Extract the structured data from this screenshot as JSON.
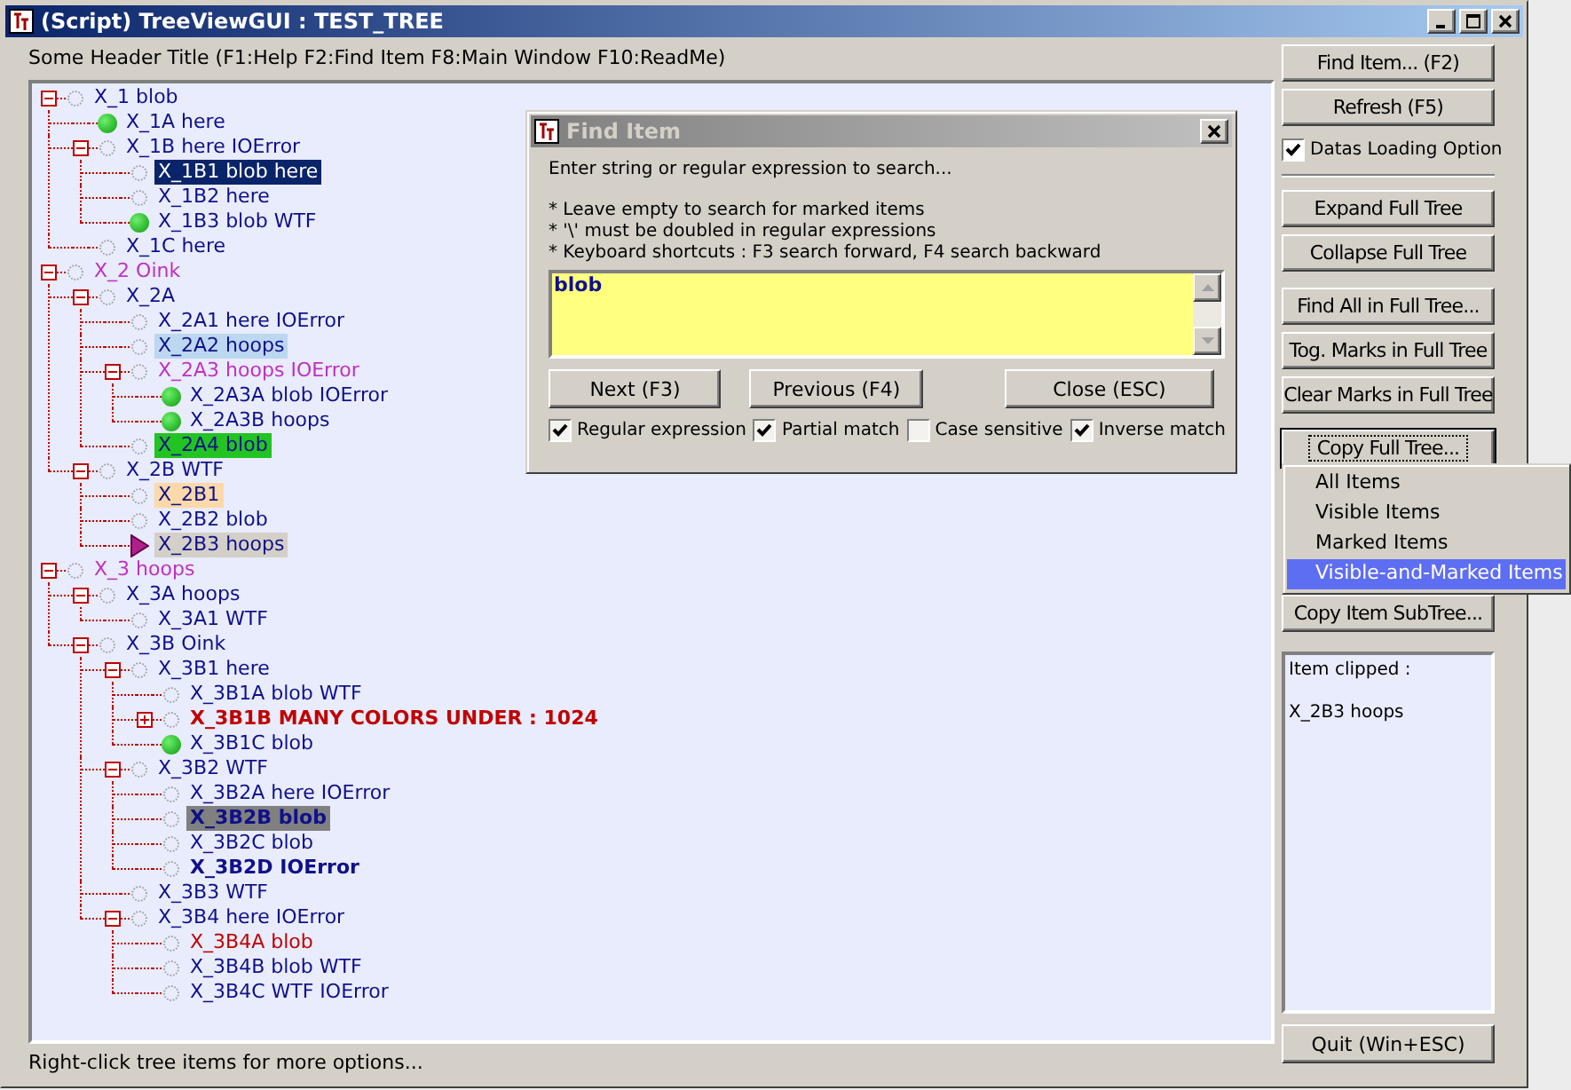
{
  "window": {
    "title": "(Script) TreeViewGUI : TEST_TREE"
  },
  "header": "Some Header Title (F1:Help F2:Find Item F8:Main Window F10:ReadMe)",
  "tree": [
    {
      "label": "X_1 blob",
      "kind": "plain",
      "color": "#10108a",
      "highlighted": false,
      "bold": false,
      "expanded": true,
      "children": [
        {
          "label": "X_1A here",
          "kind": "marked",
          "color": "#10108a",
          "highlighted": false,
          "bold": false
        },
        {
          "label": "X_1B here IOError",
          "kind": "plain",
          "color": "#10108a",
          "highlighted": false,
          "bold": false,
          "expanded": true,
          "children": [
            {
              "label": "X_1B1 blob here",
              "kind": "plain",
              "color": "#0a246a",
              "highlighted": true,
              "bold": false
            },
            {
              "label": "X_1B2 here",
              "kind": "plain",
              "color": "#10108a",
              "highlighted": false,
              "bold": false
            },
            {
              "label": "X_1B3 blob WTF",
              "kind": "marked",
              "color": "#10108a",
              "highlighted": false,
              "bold": false
            }
          ]
        },
        {
          "label": "X_1C here",
          "kind": "plain",
          "color": "#10108a",
          "highlighted": false,
          "bold": false
        }
      ]
    },
    {
      "label": "X_2 Oink",
      "kind": "plain",
      "color": "#c030c0",
      "highlighted": false,
      "bold": false,
      "expanded": true,
      "children": [
        {
          "label": "X_2A",
          "kind": "plain",
          "color": "#10108a",
          "highlighted": false,
          "bold": false,
          "expanded": true,
          "children": [
            {
              "label": "X_2A1 here IOError",
              "kind": "plain",
              "color": "#10108a",
              "highlighted": false,
              "bold": false
            },
            {
              "label": "X_2A2 hoops",
              "kind": "plain",
              "color": "#bcd7ef",
              "highlighted": true,
              "bold": false
            },
            {
              "label": "X_2A3 hoops IOError",
              "kind": "plain",
              "color": "#c030c0",
              "highlighted": false,
              "bold": false,
              "expanded": true,
              "children": [
                {
                  "label": "X_2A3A blob IOError",
                  "kind": "marked",
                  "color": "#10108a",
                  "highlighted": false,
                  "bold": false
                },
                {
                  "label": "X_2A3B hoops",
                  "kind": "marked",
                  "color": "#10108a",
                  "highlighted": false,
                  "bold": false
                }
              ]
            },
            {
              "label": "X_2A4 blob",
              "kind": "plain",
              "color": "#22c322",
              "highlighted": true,
              "bold": false
            }
          ]
        },
        {
          "label": "X_2B WTF",
          "kind": "plain",
          "color": "#10108a",
          "highlighted": false,
          "bold": false,
          "expanded": true,
          "children": [
            {
              "label": "X_2B1",
              "kind": "plain",
              "color": "#fcd9a8",
              "highlighted": true,
              "bold": false
            },
            {
              "label": "X_2B2 blob",
              "kind": "plain",
              "color": "#10108a",
              "highlighted": false,
              "bold": false
            },
            {
              "label": "X_2B3 hoops",
              "kind": "current",
              "color": "#d4d0c8",
              "highlighted": true,
              "bold": false
            }
          ]
        }
      ]
    },
    {
      "label": "X_3 hoops",
      "kind": "plain",
      "color": "#c030c0",
      "highlighted": false,
      "bold": false,
      "expanded": true,
      "children": [
        {
          "label": "X_3A hoops",
          "kind": "plain",
          "color": "#10108a",
          "highlighted": false,
          "bold": false,
          "expanded": true,
          "children": [
            {
              "label": "X_3A1 WTF",
              "kind": "plain",
              "color": "#10108a",
              "highlighted": false,
              "bold": false
            }
          ]
        },
        {
          "label": "X_3B Oink",
          "kind": "plain",
          "color": "#10108a",
          "highlighted": false,
          "bold": false,
          "expanded": true,
          "children": [
            {
              "label": "X_3B1 here",
              "kind": "plain",
              "color": "#10108a",
              "highlighted": false,
              "bold": false,
              "expanded": true,
              "children": [
                {
                  "label": "X_3B1A blob WTF",
                  "kind": "plain",
                  "color": "#10108a",
                  "highlighted": false,
                  "bold": false
                },
                {
                  "label": "X_3B1B MANY COLORS UNDER : 1024",
                  "kind": "plain",
                  "color": "#c00000",
                  "highlighted": false,
                  "bold": true,
                  "expanded": false
                },
                {
                  "label": "X_3B1C blob",
                  "kind": "marked",
                  "color": "#10108a",
                  "highlighted": false,
                  "bold": false
                }
              ]
            },
            {
              "label": "X_3B2 WTF",
              "kind": "plain",
              "color": "#10108a",
              "highlighted": false,
              "bold": false,
              "expanded": true,
              "children": [
                {
                  "label": "X_3B2A here IOError",
                  "kind": "plain",
                  "color": "#10108a",
                  "highlighted": false,
                  "bold": false
                },
                {
                  "label": "X_3B2B blob",
                  "kind": "plain",
                  "color": "#808080",
                  "highlighted": true,
                  "bold": true
                },
                {
                  "label": "X_3B2C blob",
                  "kind": "plain",
                  "color": "#10108a",
                  "highlighted": false,
                  "bold": false
                },
                {
                  "label": "X_3B2D IOError",
                  "kind": "plain",
                  "color": "#10108a",
                  "highlighted": false,
                  "bold": true
                }
              ]
            },
            {
              "label": "X_3B3 WTF",
              "kind": "plain",
              "color": "#10108a",
              "highlighted": false,
              "bold": false
            },
            {
              "label": "X_3B4 here IOError",
              "kind": "plain",
              "color": "#10108a",
              "highlighted": false,
              "bold": false,
              "expanded": true,
              "children": [
                {
                  "label": "X_3B4A blob",
                  "kind": "plain",
                  "color": "#c00000",
                  "highlighted": false,
                  "bold": false
                },
                {
                  "label": "X_3B4B blob WTF",
                  "kind": "plain",
                  "color": "#10108a",
                  "highlighted": false,
                  "bold": false
                },
                {
                  "label": "X_3B4C WTF IOError",
                  "kind": "plain",
                  "color": "#10108a",
                  "highlighted": false,
                  "bold": false
                }
              ]
            }
          ]
        }
      ]
    }
  ],
  "sidebar": [
    {
      "kind": "button",
      "label": "Find Item... (F2)",
      "focused": false
    },
    {
      "kind": "button",
      "label": "Refresh (F5)",
      "focused": false
    },
    {
      "kind": "checkbox",
      "label": "Datas Loading Option",
      "checked": true
    },
    {
      "kind": "separator"
    },
    {
      "kind": "button",
      "label": "Expand Full Tree",
      "focused": false
    },
    {
      "kind": "button",
      "label": "Collapse Full Tree",
      "focused": false
    },
    {
      "kind": "gap"
    },
    {
      "kind": "button",
      "label": "Find All in Full Tree...",
      "focused": false
    },
    {
      "kind": "button",
      "label": "Tog. Marks in Full Tree",
      "focused": false
    },
    {
      "kind": "button",
      "label": "Clear Marks in Full Tree",
      "focused": false
    },
    {
      "kind": "gap"
    },
    {
      "kind": "button",
      "label": "Copy Full Tree...",
      "focused": true
    },
    {
      "kind": "menu_space"
    },
    {
      "kind": "button",
      "label": "Copy Item SubTree...",
      "focused": false
    }
  ],
  "clip_panel": {
    "lines": [
      "Item clipped :",
      "X_2B3 hoops"
    ]
  },
  "quit_button": "Quit (Win+ESC)",
  "status_bar": "Right-click tree items for more options...",
  "find_dialog": {
    "title": "Find Item",
    "intro": "Enter string or regular expression to search...",
    "notes": [
      "* Leave empty to search for marked items",
      "* '\\' must be doubled in regular expressions",
      "* Keyboard shortcuts : F3 search forward, F4 search backward"
    ],
    "query": "blob",
    "buttons": [
      "Next (F3)",
      "Previous (F4)",
      "Close (ESC)"
    ],
    "options": [
      {
        "label": "Regular expression",
        "checked": true
      },
      {
        "label": "Partial match",
        "checked": true
      },
      {
        "label": "Case sensitive",
        "checked": false
      },
      {
        "label": "Inverse match",
        "checked": true
      }
    ]
  },
  "context_menu": {
    "items": [
      {
        "label": "All Items",
        "selected": false
      },
      {
        "label": "Visible Items",
        "selected": false
      },
      {
        "label": "Marked Items",
        "selected": false
      },
      {
        "label": "Visible-and-Marked Items",
        "selected": true
      }
    ]
  }
}
